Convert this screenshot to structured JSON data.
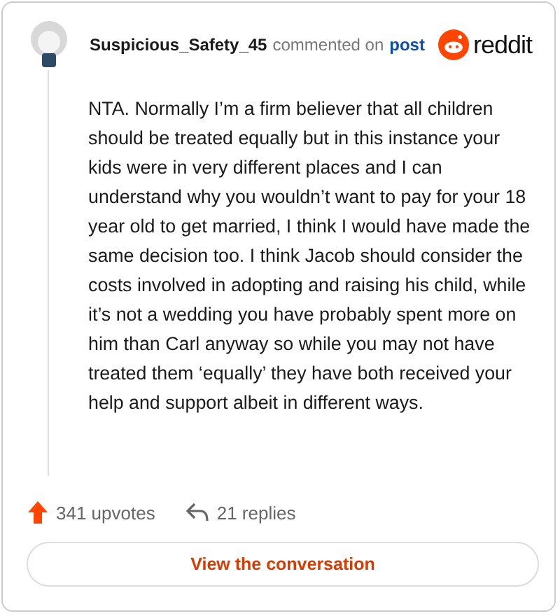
{
  "comment": {
    "author": "Suspicious_Safety_45",
    "action": "commented on",
    "link": "post",
    "brand": "reddit",
    "body": "NTA. Normally I’m a firm believer that all children should be treated equally but in this instance your kids were in very different places and I can understand why you wouldn’t want to pay for your 18 year old to get married, I think I would have made the same decision too. I think Jacob should consider the costs involved in adopting and raising his child, while it’s not a wedding you have probably spent more on him than Carl anyway so while you may not have treated them ‘equally’ they have both received your help and support albeit in different ways.",
    "upvotes": "341 upvotes",
    "replies": "21 replies"
  },
  "button": "View the conversation"
}
